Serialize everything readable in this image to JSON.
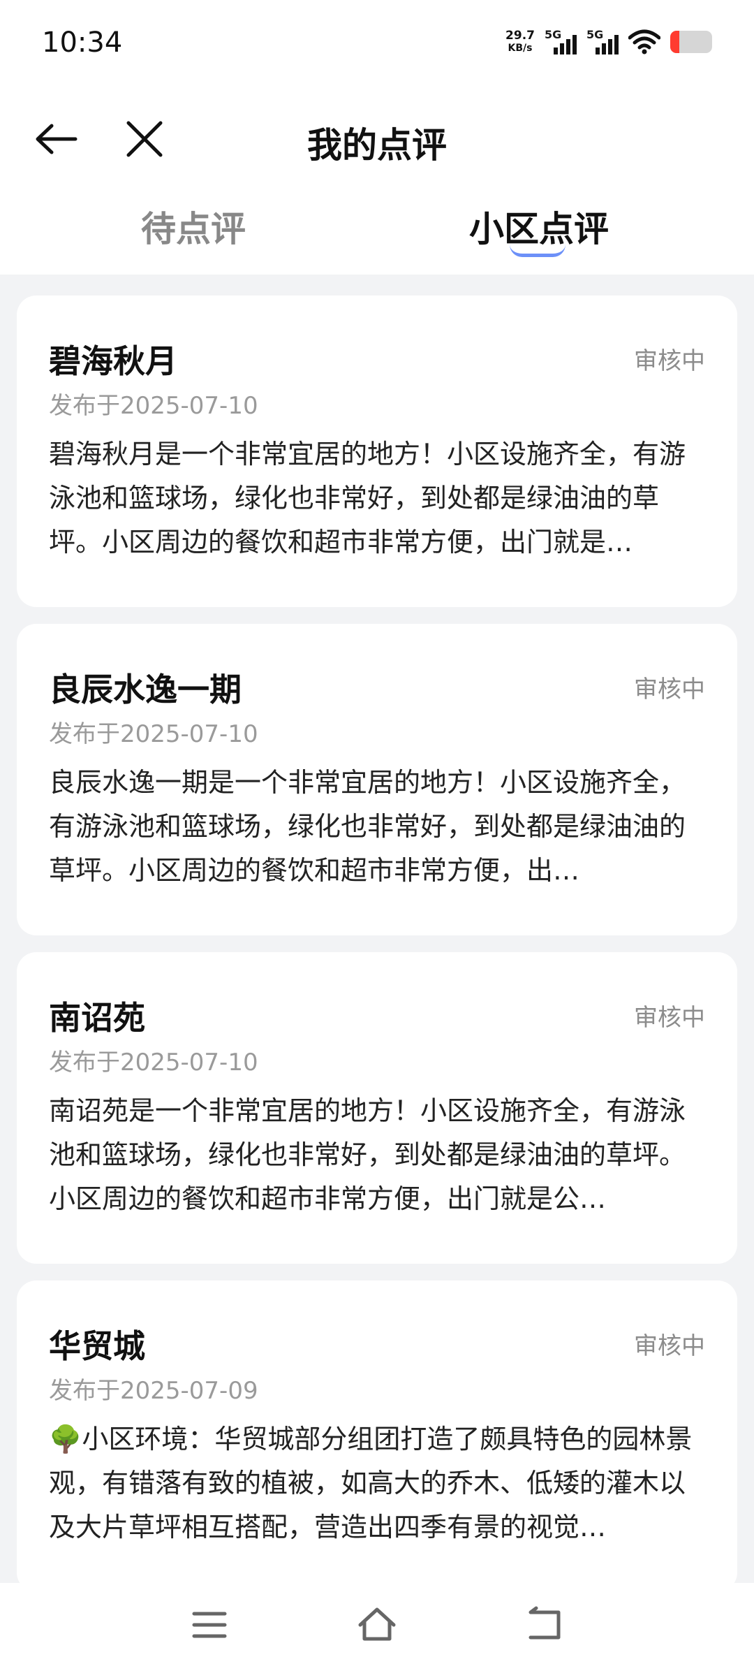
{
  "status_bar": {
    "time": "10:34",
    "net_speed_value": "29.7",
    "net_speed_unit": "KB/s",
    "signal_1_label": "5G",
    "signal_2_label": "5G",
    "battery_color": "#ff3b30"
  },
  "header": {
    "title": "我的点评",
    "back_icon": "arrow-left-icon",
    "close_icon": "close-icon"
  },
  "tabs": [
    {
      "label": "待点评",
      "active": false
    },
    {
      "label": "小区点评",
      "active": true
    }
  ],
  "accent_color": "#3b6cf6",
  "reviews": [
    {
      "title": "碧海秋月",
      "status": "审核中",
      "date": "发布于2025-07-10",
      "body": "碧海秋月是一个非常宜居的地方！小区设施齐全，有游泳池和篮球场，绿化也非常好，到处都是绿油油的草坪。小区周边的餐饮和超市非常方便，出门就是…"
    },
    {
      "title": "良辰水逸一期",
      "status": "审核中",
      "date": "发布于2025-07-10",
      "body": "良辰水逸一期是一个非常宜居的地方！小区设施齐全，有游泳池和篮球场，绿化也非常好，到处都是绿油油的草坪。小区周边的餐饮和超市非常方便，出…"
    },
    {
      "title": "南诏苑",
      "status": "审核中",
      "date": "发布于2025-07-10",
      "body": "南诏苑是一个非常宜居的地方！小区设施齐全，有游泳池和篮球场，绿化也非常好，到处都是绿油油的草坪。小区周边的餐饮和超市非常方便，出门就是公…"
    },
    {
      "title": "华贸城",
      "status": "审核中",
      "date": "发布于2025-07-09",
      "body": "🌳小区环境：华贸城部分组团打造了颇具特色的园林景观，有错落有致的植被，如高大的乔木、低矮的灌木以及大片草坪相互搭配，营造出四季有景的视觉…"
    }
  ],
  "nav_bar": {
    "menu_icon": "menu-icon",
    "home_icon": "home-icon",
    "back_icon": "back-icon"
  }
}
